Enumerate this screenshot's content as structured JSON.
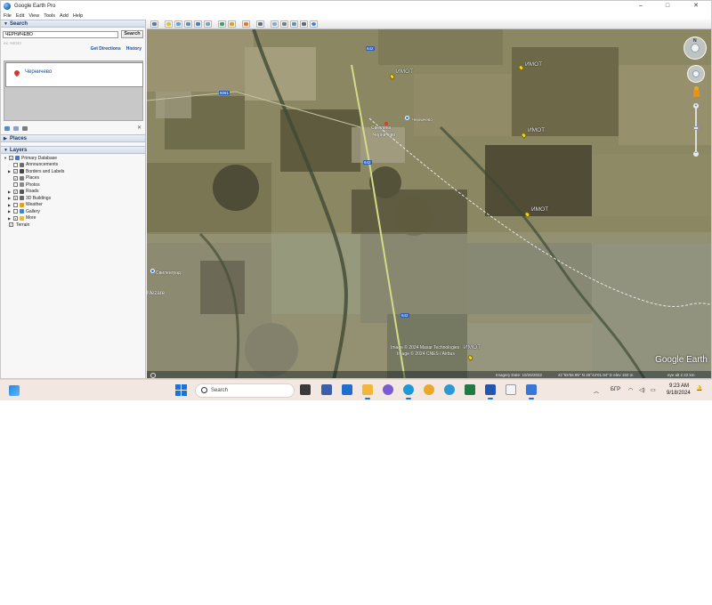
{
  "window": {
    "title": "Google Earth Pro",
    "controls": {
      "minimize": "–",
      "maximize": "□",
      "close": "✕"
    }
  },
  "menu": [
    "File",
    "Edit",
    "View",
    "Tools",
    "Add",
    "Help"
  ],
  "search": {
    "section_label": "Search",
    "input_value": "ЧЕРНИЧЕВО",
    "button_label": "Search",
    "hint": "ex: 94043",
    "get_directions": "Get Directions",
    "history": "History",
    "result": "Черничево"
  },
  "places": {
    "label": "Places"
  },
  "layers": {
    "label": "Layers",
    "items": [
      {
        "label": "Primary Database",
        "checked": "partial",
        "color": "#3a7bd5"
      },
      {
        "label": "Announcements",
        "checked": "no",
        "color": "#6c6c6c"
      },
      {
        "label": "Borders and Labels",
        "checked": "yes",
        "color": "#444444"
      },
      {
        "label": "Places",
        "checked": "yes",
        "color": "#7a7a7a"
      },
      {
        "label": "Photos",
        "checked": "no",
        "color": "#8a8a8a"
      },
      {
        "label": "Roads",
        "checked": "yes",
        "color": "#555555"
      },
      {
        "label": "3D Buildings",
        "checked": "partial",
        "color": "#6a6a6a"
      },
      {
        "label": "Weather",
        "checked": "no",
        "color": "#e0a020"
      },
      {
        "label": "Gallery",
        "checked": "no",
        "color": "#3f86d0"
      },
      {
        "label": "More",
        "checked": "partial",
        "color": "#e8b93a"
      },
      {
        "label": "Terrain",
        "checked": "yes",
        "color": "#ffffff"
      }
    ]
  },
  "map": {
    "pin_label": "ИМОТ",
    "village_label_1": "Светлина",
    "village_label_2": "Черничево",
    "road_label": "642",
    "road_label_2": "6061",
    "town_label": "Свиленград",
    "town_label_2": "Mezare",
    "copyright_1": "Image © 2024 Maxar Technologies",
    "copyright_2": "Image © 2024 CNES / Airbus",
    "logo": "Google Earth",
    "status_date": "Imagery Date: 10/26/2022",
    "status_coords": "41°55'56.95\" N  26°44'01.94\" E  elev  160 m",
    "status_eye": "eye alt  2.22 km"
  },
  "taskbar": {
    "search_label": "Search",
    "lang": "БГР",
    "time": "9:23 AM",
    "date": "9/18/2024"
  }
}
